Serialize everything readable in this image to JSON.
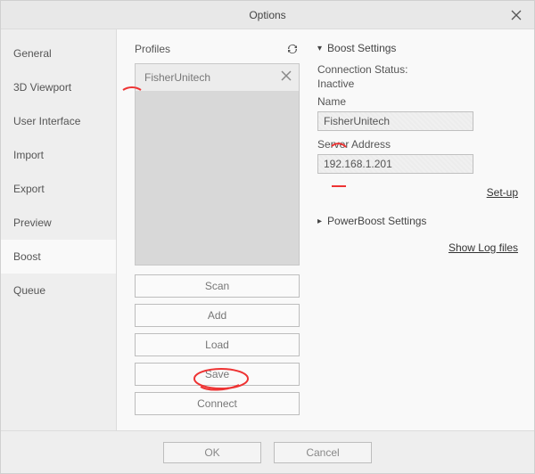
{
  "window": {
    "title": "Options"
  },
  "sidebar": {
    "items": [
      {
        "label": "General"
      },
      {
        "label": "3D Viewport"
      },
      {
        "label": "User Interface"
      },
      {
        "label": "Import"
      },
      {
        "label": "Export"
      },
      {
        "label": "Preview"
      },
      {
        "label": "Boost"
      },
      {
        "label": "Queue"
      }
    ],
    "active_index": 6
  },
  "profiles": {
    "header": "Profiles",
    "items": [
      {
        "name": "FisherUnitech"
      }
    ],
    "buttons": {
      "scan": "Scan",
      "add": "Add",
      "load": "Load",
      "save": "Save",
      "connect": "Connect"
    }
  },
  "boost": {
    "section_label": "Boost Settings",
    "connection_status_label": "Connection Status:",
    "connection_status_value": "Inactive",
    "name_label": "Name",
    "name_value": "FisherUnitech",
    "server_label": "Server Address",
    "server_value": "192.168.1.201",
    "setup_link": "Set-up",
    "powerboost_label": "PowerBoost Settings",
    "show_log_link": "Show Log files"
  },
  "footer": {
    "ok": "OK",
    "cancel": "Cancel"
  }
}
